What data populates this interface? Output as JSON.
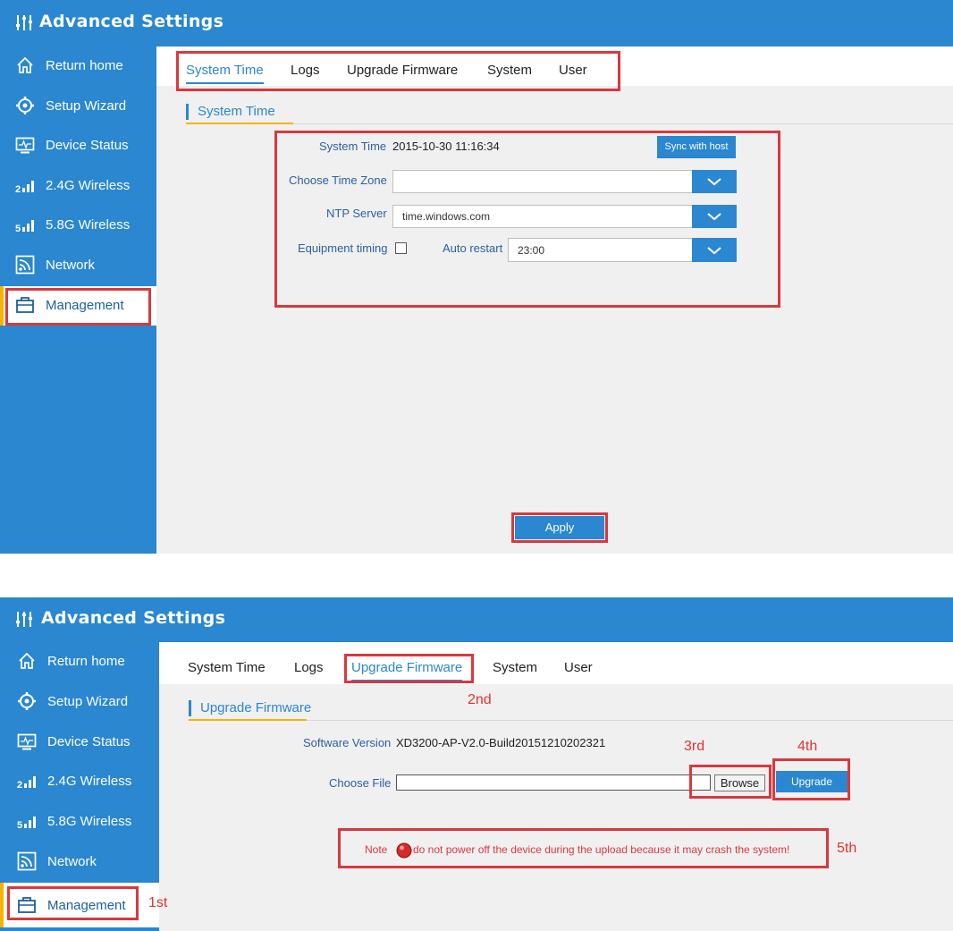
{
  "panel1": {
    "header": {
      "title": "Advanced Settings"
    },
    "sidebar": {
      "items": [
        {
          "label": "Return home",
          "icon": "home-icon"
        },
        {
          "label": "Setup Wizard",
          "icon": "gear-icon"
        },
        {
          "label": "Device Status",
          "icon": "monitor-icon"
        },
        {
          "label": "2.4G Wireless",
          "icon": "signal-icon"
        },
        {
          "label": "5.8G Wireless",
          "icon": "signal-icon"
        },
        {
          "label": "Network",
          "icon": "network-icon"
        },
        {
          "label": "Management",
          "icon": "toolbox-icon"
        }
      ]
    },
    "tabs": [
      "System Time",
      "Logs",
      "Upgrade Firmware",
      "System",
      "User"
    ],
    "section_title": "System Time",
    "form": {
      "system_time_label": "System Time",
      "system_time_value": "2015-10-30 11:16:34",
      "sync_button": "Sync with host",
      "timezone_label": "Choose Time Zone",
      "timezone_value": "",
      "ntp_label": "NTP Server",
      "ntp_value": "time.windows.com",
      "equipment_timing_label": "Equipment timing",
      "equipment_timing_checked": false,
      "auto_restart_label": "Auto restart",
      "auto_restart_value": "23:00"
    },
    "apply_button": "Apply"
  },
  "panel2": {
    "header": {
      "title": "Advanced Settings"
    },
    "sidebar": {
      "items": [
        {
          "label": "Return home",
          "icon": "home-icon"
        },
        {
          "label": "Setup Wizard",
          "icon": "gear-icon"
        },
        {
          "label": "Device Status",
          "icon": "monitor-icon"
        },
        {
          "label": "2.4G Wireless",
          "icon": "signal-icon"
        },
        {
          "label": "5.8G Wireless",
          "icon": "signal-icon"
        },
        {
          "label": "Network",
          "icon": "network-icon"
        },
        {
          "label": "Management",
          "icon": "toolbox-icon"
        }
      ]
    },
    "tabs": [
      "System Time",
      "Logs",
      "Upgrade Firmware",
      "System",
      "User"
    ],
    "section_title": "Upgrade Firmware",
    "software_version_label": "Software Version",
    "software_version_value": "XD3200-AP-V2.0-Build20151210202321",
    "choose_file_label": "Choose File",
    "browse_button": "Browse",
    "upgrade_button": "Upgrade",
    "note_label": "Note",
    "note_text": "do not power off the device during the upload because it may crash the system!",
    "annotations": {
      "first": "1st",
      "second": "2nd",
      "third": "3rd",
      "fourth": "4th",
      "fifth": "5th"
    }
  },
  "colors": {
    "primary": "#2a87d0",
    "highlight_box": "#d9383d",
    "active_indicator": "#f4b400",
    "label": "#2d5f9e"
  }
}
